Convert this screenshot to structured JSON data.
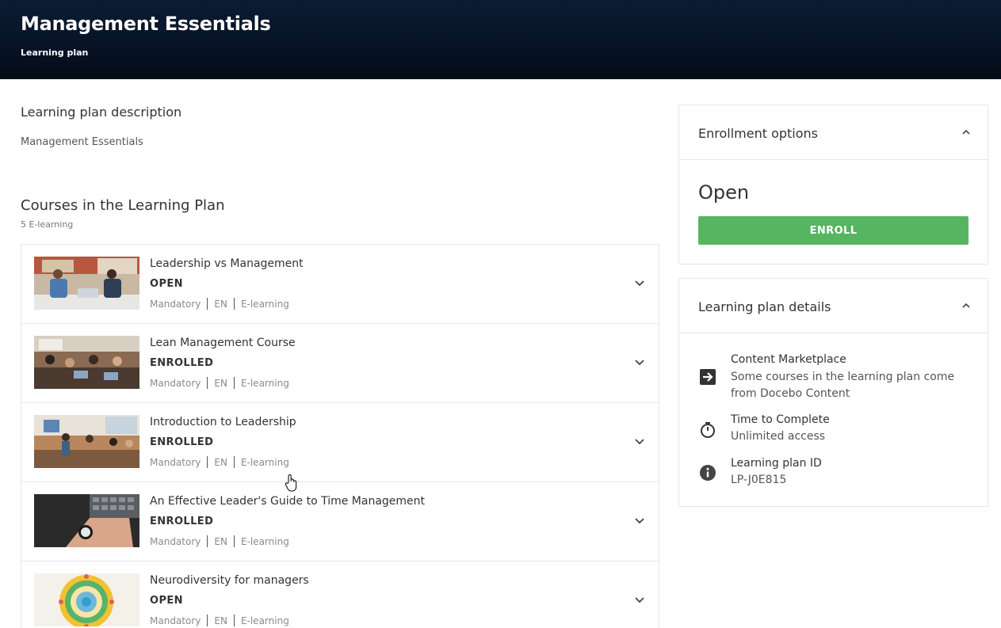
{
  "header": {
    "title": "Management Essentials",
    "subtitle": "Learning plan"
  },
  "description": {
    "title": "Learning plan description",
    "text": "Management Essentials"
  },
  "courses_section": {
    "title": "Courses in the Learning Plan",
    "count": "5 E-learning",
    "courses": [
      {
        "title": "Leadership vs Management",
        "status": "OPEN",
        "mandatory": "Mandatory",
        "language": "EN",
        "type": "E-learning"
      },
      {
        "title": "Lean Management Course",
        "status": "ENROLLED",
        "mandatory": "Mandatory",
        "language": "EN",
        "type": "E-learning"
      },
      {
        "title": "Introduction to Leadership",
        "status": "ENROLLED",
        "mandatory": "Mandatory",
        "language": "EN",
        "type": "E-learning"
      },
      {
        "title": "An Effective Leader's Guide to Time Management",
        "status": "ENROLLED",
        "mandatory": "Mandatory",
        "language": "EN",
        "type": "E-learning"
      },
      {
        "title": "Neurodiversity for managers",
        "status": "OPEN",
        "mandatory": "Mandatory",
        "language": "EN",
        "type": "E-learning"
      }
    ]
  },
  "enrollment": {
    "title": "Enrollment options",
    "state": "Open",
    "button_label": "ENROLL"
  },
  "details": {
    "title": "Learning plan details",
    "content_marketplace_label": "Content Marketplace",
    "content_marketplace_value": "Some courses in the learning plan come from Docebo Content",
    "time_label": "Time to Complete",
    "time_value": "Unlimited access",
    "id_label": "Learning plan ID",
    "id_value": "LP-J0E815"
  },
  "icons": {
    "chevron": "chevron-down-icon",
    "collapse": "chevron-up-icon",
    "marketplace": "arrow-into-box-icon",
    "timer": "stopwatch-icon",
    "info": "info-icon"
  },
  "colors": {
    "header_bg": "#071325",
    "enroll_button": "#56b560",
    "border": "#e4e6e8"
  }
}
